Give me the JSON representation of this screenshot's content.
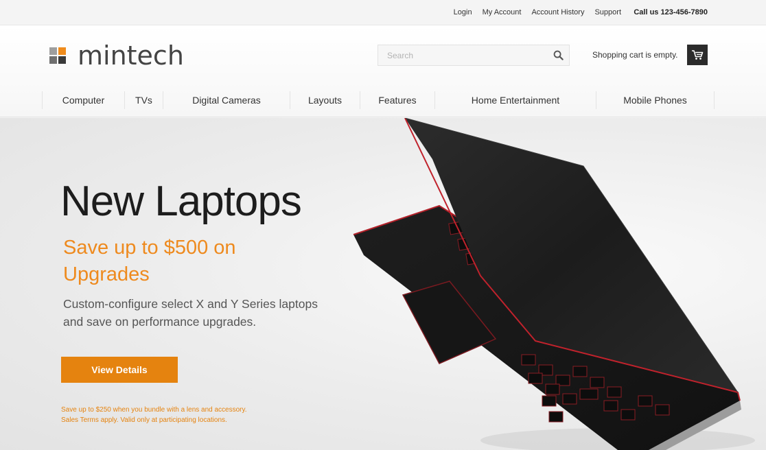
{
  "topbar": {
    "links": [
      "Login",
      "My Account",
      "Account History",
      "Support"
    ],
    "call_label": "Call us 123-456-7890"
  },
  "header": {
    "logo_text": "mintech",
    "logo_colors": [
      "#9e9e9e",
      "#f08c1c",
      "#707070",
      "#3a3a3a"
    ],
    "search_placeholder": "Search",
    "cart_text": "Shopping cart is empty."
  },
  "nav": {
    "items": [
      "Computer",
      "TVs",
      "Digital Cameras",
      "Layouts",
      "Features",
      "Home Entertainment",
      "Mobile Phones"
    ]
  },
  "hero": {
    "title": "New Laptops",
    "subtitle": "Save up to $500 on Upgrades",
    "description": "Custom-configure select X and Y Series laptops and save on performance upgrades.",
    "button_label": "View Details",
    "note_line1": "Save up to $250 when you bundle with a lens and accessory.",
    "note_line2": "Sales Terms apply. Valid only at participating locations."
  },
  "colors": {
    "accent": "#e5830f",
    "text_dark": "#1d1d1d"
  }
}
